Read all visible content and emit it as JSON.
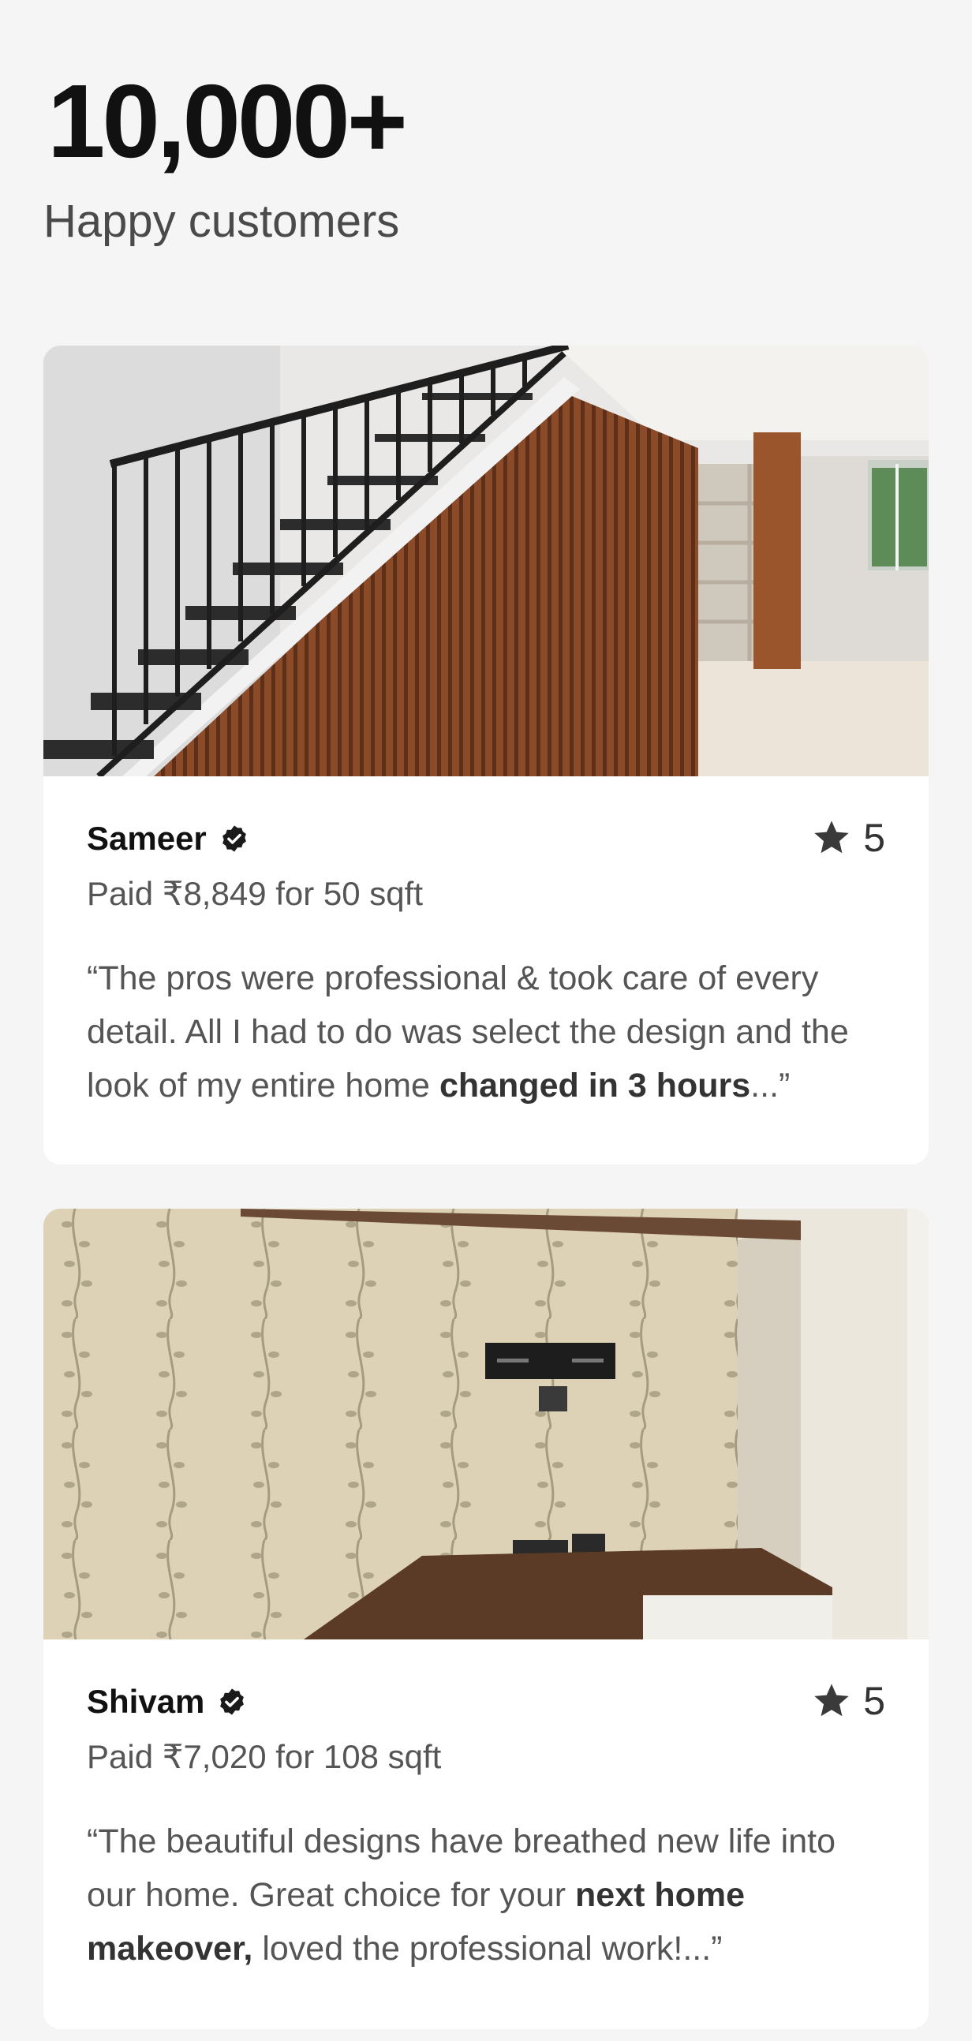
{
  "stats": {
    "number": "10,000+",
    "label": "Happy customers"
  },
  "reviews": [
    {
      "name": "Sameer",
      "rating": "5",
      "paid": "Paid ₹8,849 for 50 sqft",
      "quote_before": "“The pros were professional & took care of every detail. All I had to do was select the design and the look of my entire home ",
      "quote_bold": "changed in 3 hours",
      "quote_after": "...”",
      "photo": "staircase with wooden slat panelling and black railing"
    },
    {
      "name": "Shivam",
      "rating": "5",
      "paid": "Paid ₹7,020 for 108 sqft",
      "quote_before": "“The beautiful designs have breathed new life into our home. Great choice for your ",
      "quote_bold": "next home makeover,",
      "quote_after": " loved the professional work!...”",
      "photo": "floral wallpaper TV unit wall with wooden shelf"
    }
  ],
  "icons": {
    "verified": "verified-badge-icon",
    "star": "star-icon"
  },
  "colors": {
    "background": "#f5f5f5",
    "card": "#ffffff",
    "wood": "#8a4a2a"
  }
}
